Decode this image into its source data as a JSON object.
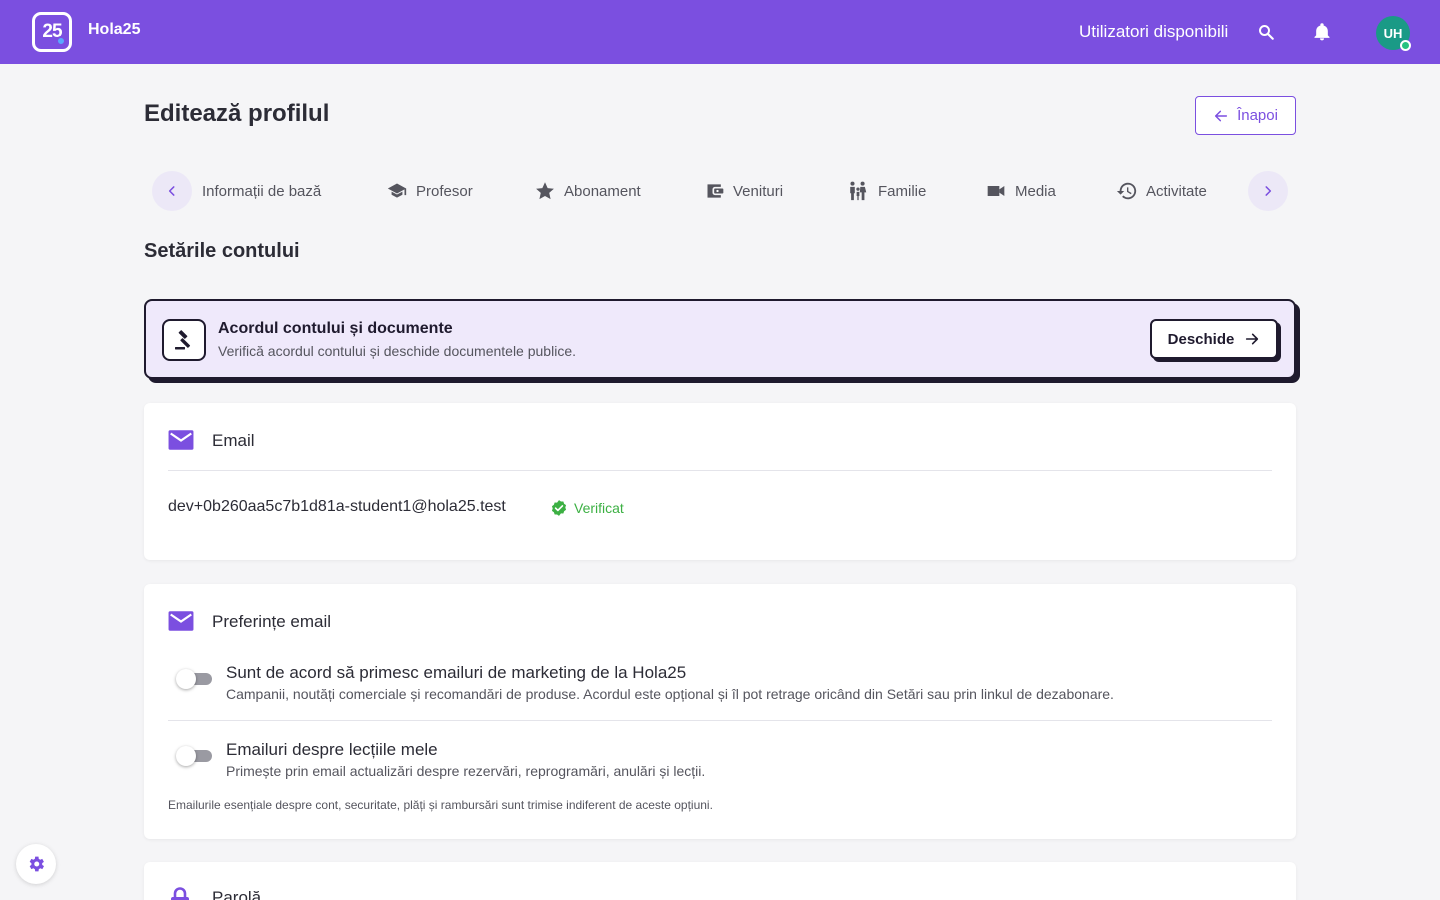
{
  "topbar": {
    "logo_text": "25",
    "app_name": "Hola25",
    "available_users_link": "Utilizatori disponibili",
    "avatar_initials": "UH"
  },
  "page": {
    "title": "Editează profilul",
    "back_label": "Înapoi"
  },
  "tabs": [
    {
      "label": "Informații de bază",
      "icon": "info-icon"
    },
    {
      "label": "Profesor",
      "icon": "graduation-cap-icon"
    },
    {
      "label": "Abonament",
      "icon": "star-icon"
    },
    {
      "label": "Venituri",
      "icon": "wallet-icon"
    },
    {
      "label": "Familie",
      "icon": "family-icon"
    },
    {
      "label": "Media",
      "icon": "video-camera-icon"
    },
    {
      "label": "Activitate",
      "icon": "history-icon"
    }
  ],
  "section_title": "Setările contului",
  "agreement": {
    "title": "Acordul contului și documente",
    "subtitle": "Verifică acordul contului și deschide documentele publice.",
    "open_label": "Deschide",
    "icon": "gavel-icon"
  },
  "email_card": {
    "title": "Email",
    "address": "dev+0b260aa5c7b1d81a-student1@hola25.test",
    "status": "Verificat"
  },
  "prefs_card": {
    "title": "Preferințe email",
    "items": [
      {
        "title": "Sunt de acord să primesc emailuri de marketing de la Hola25",
        "description": "Campanii, noutăți comerciale și recomandări de produse. Acordul este opțional și îl pot retrage oricând din Setări sau prin linkul de dezabonare.",
        "enabled": false
      },
      {
        "title": "Emailuri despre lecțiile mele",
        "description": "Primește prin email actualizări despre rezervări, reprogramări, anulări și lecții.",
        "enabled": false
      }
    ],
    "note": "Emailurile esențiale despre cont, securitate, plăți și rambursări sunt trimise indiferent de aceste opțiuni."
  },
  "password_card": {
    "title": "Parolă"
  },
  "colors": {
    "primary": "#7b4fe0",
    "agreement_bg": "#efe9fb",
    "verified": "#3cb043",
    "page_bg": "#f5f5f7"
  }
}
